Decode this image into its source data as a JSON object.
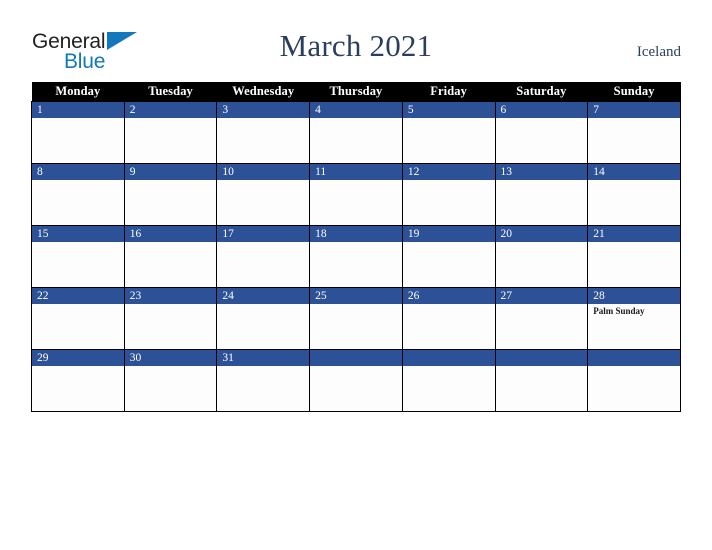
{
  "brand": {
    "name_part1": "General",
    "name_part2": "Blue",
    "triangle_color": "#1277bc",
    "text_color": "#231f20"
  },
  "header": {
    "title": "March 2021",
    "region": "Iceland",
    "title_color": "#2c3e5d"
  },
  "calendar": {
    "weekday_headers": [
      "Monday",
      "Tuesday",
      "Wednesday",
      "Thursday",
      "Friday",
      "Saturday",
      "Sunday"
    ],
    "header_bg": "#000000",
    "daybar_bg": "#2d5196",
    "cell_bg": "#fdfdfd",
    "weeks": [
      [
        {
          "day": "1",
          "event": ""
        },
        {
          "day": "2",
          "event": ""
        },
        {
          "day": "3",
          "event": ""
        },
        {
          "day": "4",
          "event": ""
        },
        {
          "day": "5",
          "event": ""
        },
        {
          "day": "6",
          "event": ""
        },
        {
          "day": "7",
          "event": ""
        }
      ],
      [
        {
          "day": "8",
          "event": ""
        },
        {
          "day": "9",
          "event": ""
        },
        {
          "day": "10",
          "event": ""
        },
        {
          "day": "11",
          "event": ""
        },
        {
          "day": "12",
          "event": ""
        },
        {
          "day": "13",
          "event": ""
        },
        {
          "day": "14",
          "event": ""
        }
      ],
      [
        {
          "day": "15",
          "event": ""
        },
        {
          "day": "16",
          "event": ""
        },
        {
          "day": "17",
          "event": ""
        },
        {
          "day": "18",
          "event": ""
        },
        {
          "day": "19",
          "event": ""
        },
        {
          "day": "20",
          "event": ""
        },
        {
          "day": "21",
          "event": ""
        }
      ],
      [
        {
          "day": "22",
          "event": ""
        },
        {
          "day": "23",
          "event": ""
        },
        {
          "day": "24",
          "event": ""
        },
        {
          "day": "25",
          "event": ""
        },
        {
          "day": "26",
          "event": ""
        },
        {
          "day": "27",
          "event": ""
        },
        {
          "day": "28",
          "event": "Palm Sunday"
        }
      ],
      [
        {
          "day": "29",
          "event": ""
        },
        {
          "day": "30",
          "event": ""
        },
        {
          "day": "31",
          "event": ""
        },
        {
          "day": "",
          "event": ""
        },
        {
          "day": "",
          "event": ""
        },
        {
          "day": "",
          "event": ""
        },
        {
          "day": "",
          "event": ""
        }
      ]
    ]
  }
}
